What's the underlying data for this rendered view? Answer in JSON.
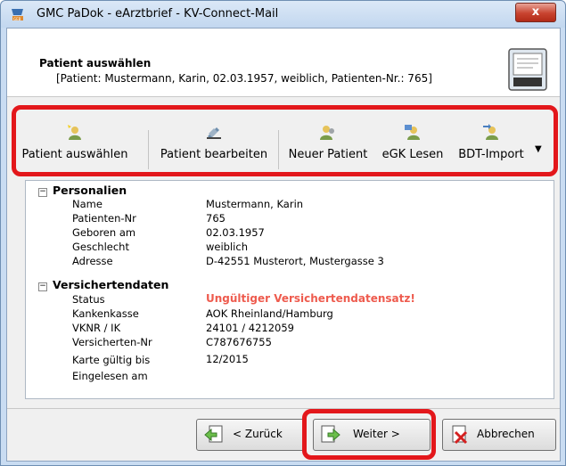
{
  "window": {
    "title": "GMC PaDok  -  eArztbrief  -  KV-Connect-Mail",
    "close_label": "x"
  },
  "header": {
    "title": "Patient auswählen",
    "subtitle": "[Patient:  Mustermann, Karin,  02.03.1957,  weiblich,  Patienten-Nr.: 765]"
  },
  "toolbar": {
    "buttons": [
      {
        "label": "Patient auswählen",
        "icon": "patient-select-icon"
      },
      {
        "label": "Patient bearbeiten",
        "icon": "patient-edit-icon"
      },
      {
        "label": "Neuer Patient",
        "icon": "new-patient-icon"
      },
      {
        "label": "eGK Lesen",
        "icon": "egk-read-icon"
      },
      {
        "label": "BDT-Import",
        "icon": "bdt-import-icon"
      }
    ],
    "more_icon": "dropdown-arrow-icon"
  },
  "personalien": {
    "heading": "Personalien",
    "rows": [
      {
        "label": "Name",
        "value": "Mustermann, Karin"
      },
      {
        "label": "Patienten-Nr",
        "value": "765"
      },
      {
        "label": "Geboren am",
        "value": "02.03.1957"
      },
      {
        "label": "Geschlecht",
        "value": "weiblich"
      },
      {
        "label": "Adresse",
        "value": "D-42551 Musterort, Mustergasse 3"
      }
    ]
  },
  "versichertendaten": {
    "heading": "Versichertendaten",
    "rows": [
      {
        "label": "Status",
        "value": "Ungültiger Versichertendatensatz!"
      },
      {
        "label": "Kankenkasse",
        "value": "AOK Rheinland/Hamburg"
      },
      {
        "label": "VKNR / IK",
        "value": "24101 / 4212059"
      },
      {
        "label": "Versicherten-Nr",
        "value": "C787676755"
      },
      {
        "label": "Karte gültig bis",
        "value": "12/2015"
      },
      {
        "label": "Eingelesen am",
        "value": ""
      }
    ]
  },
  "footer": {
    "back_label": "< Zurück",
    "next_label": "Weiter >",
    "cancel_label": "Abbrechen"
  },
  "colors": {
    "highlight": "#e3171b",
    "warning": "#ee5b4e"
  }
}
